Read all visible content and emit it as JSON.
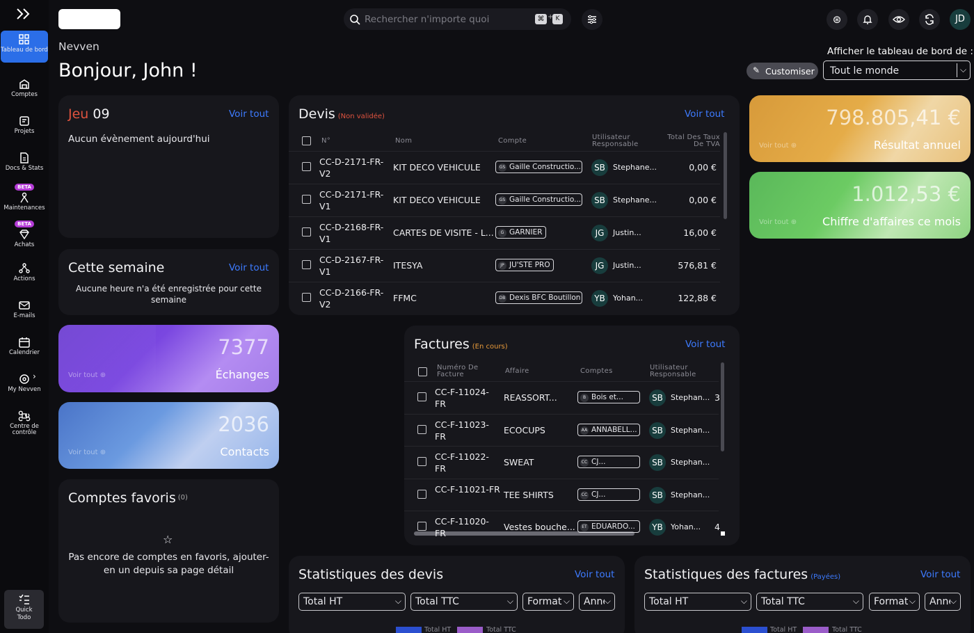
{
  "sidebar": {
    "items": [
      {
        "label": "Tableau de bord",
        "icon": "dashboard-icon"
      },
      {
        "label": "Comptes",
        "icon": "accounts-icon"
      },
      {
        "label": "Projets",
        "icon": "projects-icon"
      },
      {
        "label": "Docs & Stats",
        "icon": "docs-icon"
      },
      {
        "label": "Maintenances",
        "icon": "maintenance-icon",
        "badge": "BETA"
      },
      {
        "label": "Achats",
        "icon": "purchases-icon",
        "badge": "BETA"
      },
      {
        "label": "Actions",
        "icon": "actions-icon"
      },
      {
        "label": "E-mails",
        "icon": "mail-icon"
      },
      {
        "label": "Calendrier",
        "icon": "calendar-icon"
      },
      {
        "label": "My Nevven",
        "icon": "settings-icon"
      },
      {
        "label": "Centre de contrôle",
        "icon": "control-center-icon"
      }
    ],
    "quick": "Quick Todo"
  },
  "header": {
    "search_placeholder": "Rechercher n'importe quoi",
    "kbd1": "⌘",
    "kbd_plus": "+",
    "kbd2": "K",
    "avatar": "JD",
    "company": "Nevven",
    "greeting": "Bonjour, John !",
    "dashboard_for": "Afficher le tableau de bord de :",
    "customize": "Customiser",
    "everyone": "Tout le monde"
  },
  "agenda": {
    "day": "Jeu",
    "date": "09",
    "link": "Voir tout",
    "empty": "Aucun évènement aujourd'hui"
  },
  "week": {
    "title": "Cette semaine",
    "link": "Voir tout",
    "empty": "Aucune heure n'a été enregistrée pour cette semaine"
  },
  "kpi_left": [
    {
      "value": "7377",
      "label": "Échanges",
      "link": "Voir tout"
    },
    {
      "value": "2036",
      "label": "Contacts",
      "link": "Voir tout"
    }
  ],
  "favorites": {
    "title": "Comptes favoris",
    "count": "(0)",
    "empty": "Pas encore de comptes en favoris, ajouter-en un depuis sa page détail"
  },
  "quotes": {
    "title": "Devis",
    "tag": "(Non validée)",
    "link": "Voir tout",
    "headers": [
      "N°",
      "Nom",
      "Compte",
      "Utilisateur Responsable",
      "Total Des Taux De TVA"
    ],
    "rows": [
      {
        "num1": "CC-D-2171-FR-",
        "num2": "V2",
        "name": "KIT DECO VEHICULE",
        "ini": "GS",
        "account": "Gaille Constructio...",
        "avatar": "SB",
        "user": "Stephane...",
        "total": "0,00 €"
      },
      {
        "num1": "CC-D-2171-FR-",
        "num2": "V1",
        "name": "KIT DECO VEHICULE",
        "ini": "GS",
        "account": "Gaille Constructio...",
        "avatar": "SB",
        "user": "Stephane...",
        "total": "0,00 €"
      },
      {
        "num1": "CC-D-2168-FR-",
        "num2": "V1",
        "name": "CARTES DE VISITE - L...",
        "ini": "G",
        "account": "GARNIER",
        "avatar": "JG",
        "user": "Justin...",
        "total": "16,00 €"
      },
      {
        "num1": "CC-D-2167-FR-",
        "num2": "V1",
        "name": "ITESYA",
        "ini": "JP",
        "account": "JU'STE PRO",
        "avatar": "JG",
        "user": "Justin...",
        "total": "576,81 €"
      },
      {
        "num1": "CC-D-2166-FR-",
        "num2": "V2",
        "name": "FFMC",
        "ini": "DB",
        "account": "Dexis BFC Boutillon",
        "avatar": "YB",
        "user": "Yohan...",
        "total": "122,88 €"
      }
    ]
  },
  "invoices": {
    "title": "Factures",
    "tag": "(En cours)",
    "link": "Voir tout",
    "headers": [
      "Numéro De Facture",
      "Affaire",
      "Comptes",
      "Utilisateur Responsable"
    ],
    "rows": [
      {
        "num1": "CC-F-11024-",
        "num2": "FR",
        "deal": "REASSORT...",
        "ini": "B",
        "account": "Bois et...",
        "avatar": "SB",
        "user": "Stephan...",
        "extra": "3"
      },
      {
        "num1": "CC-F-11023-",
        "num2": "FR",
        "deal": "ECOCUPS",
        "ini": "AA",
        "account": "ANNABELL...",
        "avatar": "SB",
        "user": "Stephan...",
        "extra": ""
      },
      {
        "num1": "CC-F-11022-",
        "num2": "FR",
        "deal": "SWEAT",
        "ini": "CC",
        "account": "CJ...",
        "avatar": "SB",
        "user": "Stephan...",
        "extra": ""
      },
      {
        "num1": "CC-F-11021-FR",
        "num2": "",
        "deal": "TEE SHIRTS",
        "ini": "CC",
        "account": "CJ...",
        "avatar": "SB",
        "user": "Stephan...",
        "extra": ""
      },
      {
        "num1": "CC-F-11020-",
        "num2": "FR",
        "deal": "Vestes bouche...",
        "ini": "ET",
        "account": "EDUARDO...",
        "avatar": "YB",
        "user": "Yohan...",
        "extra": "4"
      }
    ]
  },
  "kpi_right": [
    {
      "value": "798.805,41 €",
      "label": "Résultat annuel",
      "link": "Voir tout"
    },
    {
      "value": "1.012,53 €",
      "label": "Chiffre d'affaires ce mois",
      "link": "Voir tout"
    }
  ],
  "stats_quotes": {
    "title": "Statistiques des devis",
    "link": "Voir tout",
    "selects": [
      "Total HT",
      "Total TTC",
      "Format",
      "Anné"
    ],
    "legend": [
      "Total HT",
      "Total TTC"
    ]
  },
  "stats_invoices": {
    "title": "Statistiques des factures",
    "tag": "(Payées)",
    "link": "Voir tout",
    "selects": [
      "Total HT",
      "Total TTC",
      "Format",
      "Anné"
    ],
    "legend": [
      "Total HT",
      "Total TTC"
    ]
  },
  "colors": {
    "accent": "#2b6ee8",
    "link": "#3d7bff",
    "danger": "#e0533f",
    "beta": "#b43bd6"
  }
}
